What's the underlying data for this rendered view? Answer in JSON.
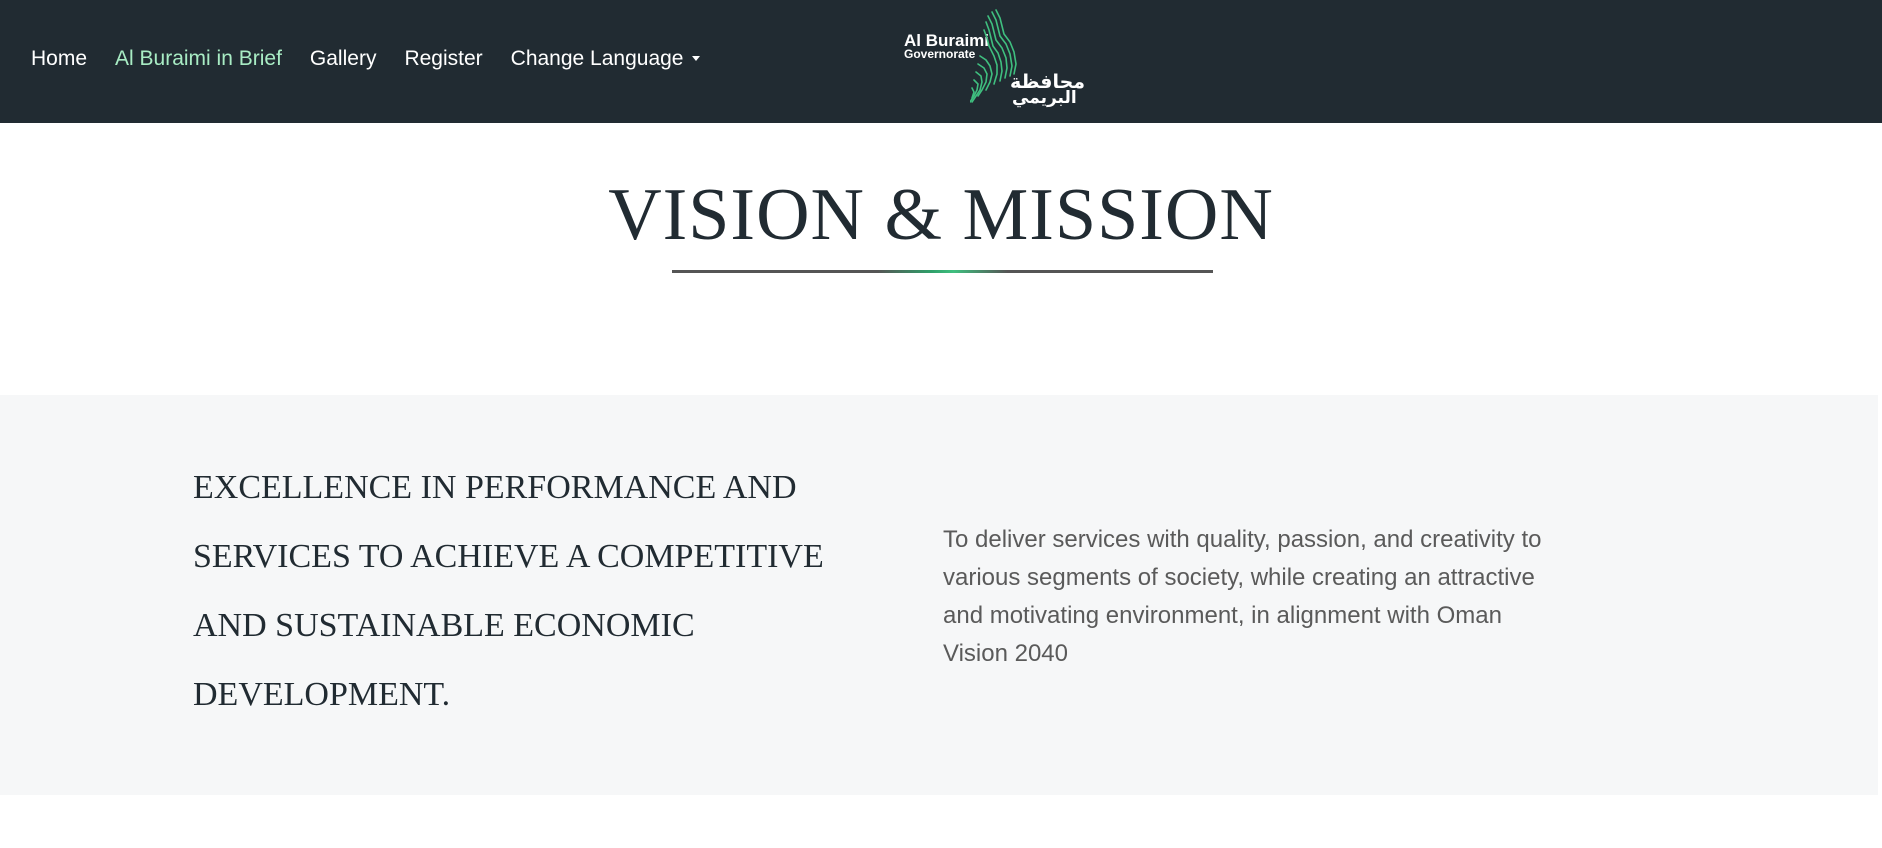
{
  "nav": {
    "items": [
      {
        "label": "Home",
        "active": false
      },
      {
        "label": "Al Buraimi in Brief",
        "active": true
      },
      {
        "label": "Gallery",
        "active": false
      },
      {
        "label": "Register",
        "active": false
      },
      {
        "label": "Change Language",
        "active": false,
        "icon": "caret-down-icon"
      }
    ]
  },
  "logo": {
    "name_en_line1": "Al Buraimi",
    "name_en_line2": "Governorate",
    "name_ar_line1": "محافظة",
    "name_ar_line2": "البريمي",
    "accent_color": "#3fbf7f"
  },
  "page": {
    "title": "VISION & MISSION"
  },
  "vision": {
    "text": "EXCELLENCE IN PERFORMANCE AND SERVICES TO ACHIEVE A COMPETITIVE AND SUSTAINABLE ECONOMIC DEVELOPMENT."
  },
  "mission": {
    "text": "To deliver services with quality, passion, and creativity to various segments of society, while creating an attractive and motivating environment, in alignment with Oman Vision 2040"
  },
  "colors": {
    "navbar_bg": "#212b32",
    "active_link": "#a8ecc4",
    "band_bg": "#f6f7f8",
    "title": "#212b32"
  }
}
